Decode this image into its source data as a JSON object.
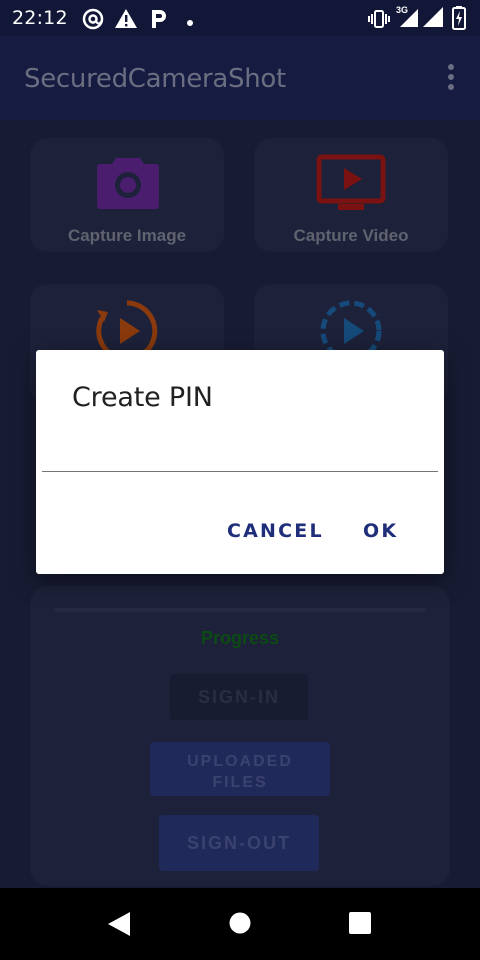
{
  "status_bar": {
    "time": "22:12",
    "left_icons": [
      "at-sign-icon",
      "warning-icon",
      "parking-icon",
      "dot-icon"
    ],
    "right_icons": [
      "vibrate-icon",
      "signal-3g-icon",
      "signal-icon",
      "battery-icon"
    ],
    "network_label": "3G"
  },
  "app_bar": {
    "title": "SecuredCameraShot",
    "menu_icon": "overflow-menu-icon"
  },
  "main": {
    "cards": [
      {
        "label": "Capture Image",
        "icon": "camera-icon",
        "color": "#4a1d6e"
      },
      {
        "label": "Capture Video",
        "icon": "video-screen-icon",
        "color": "#7a1212"
      },
      {
        "label": "",
        "icon": "replay-icon",
        "color": "#8a3a0c"
      },
      {
        "label": "",
        "icon": "play-circle-icon",
        "color": "#154a7a"
      }
    ],
    "progress_label": "Progress",
    "sign_in_label": "SIGN-IN",
    "uploaded_files_label": "UPLOADED\nFILES",
    "sign_out_label": "SIGN-OUT"
  },
  "dialog": {
    "title": "Create PIN",
    "input_value": "",
    "cancel_label": "CANCEL",
    "ok_label": "OK"
  },
  "nav_bar": {
    "icons": [
      "back-icon",
      "home-icon",
      "recents-icon"
    ]
  },
  "colors": {
    "app_bar": "#161b42",
    "background": "#181c33",
    "dialog_button": "#1f2e7a",
    "progress_label": "#0c4a14"
  }
}
